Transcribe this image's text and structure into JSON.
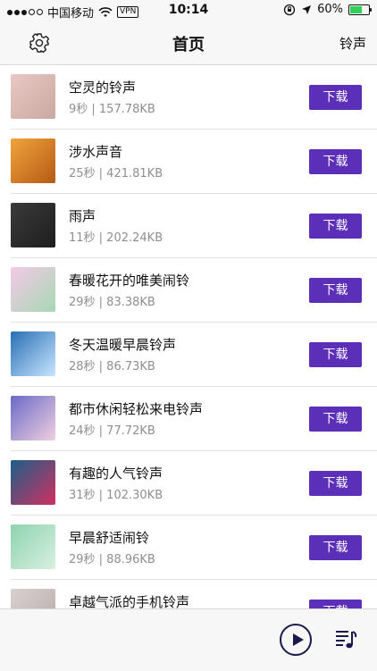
{
  "status_bar": {
    "carrier": "中国移动",
    "vpn": "VPN",
    "time": "10:14",
    "battery": "60%"
  },
  "nav": {
    "title": "首页",
    "right_label": "铃声",
    "settings_icon": "gear-icon"
  },
  "list": {
    "download_label": "下载",
    "items": [
      {
        "name": "空灵的铃声",
        "meta": "9秒 | 157.78KB",
        "thumb": [
          "#e9c8c4",
          "#c9a9a0"
        ]
      },
      {
        "name": "涉水声音",
        "meta": "25秒 | 421.81KB",
        "thumb": [
          "#f0a43a",
          "#b55a17"
        ]
      },
      {
        "name": "雨声",
        "meta": "11秒 | 202.24KB",
        "thumb": [
          "#3a3a3a",
          "#1e1e1e"
        ]
      },
      {
        "name": "春暖花开的唯美闹铃",
        "meta": "29秒 | 83.38KB",
        "thumb": [
          "#f4c9e6",
          "#a7d8b4"
        ]
      },
      {
        "name": "冬天温暖早晨铃声",
        "meta": "28秒 | 86.73KB",
        "thumb": [
          "#2a6fb5",
          "#c7e6ff"
        ]
      },
      {
        "name": "都市休闲轻松来电铃声",
        "meta": "24秒 | 77.72KB",
        "thumb": [
          "#6a6ac7",
          "#f0d0e0"
        ]
      },
      {
        "name": "有趣的人气铃声",
        "meta": "31秒 | 102.30KB",
        "thumb": [
          "#1b5f8a",
          "#d03060"
        ]
      },
      {
        "name": "早晨舒适闹铃",
        "meta": "29秒 | 88.96KB",
        "thumb": [
          "#8fd3b0",
          "#d8f0e0"
        ]
      },
      {
        "name": "卓越气派的手机铃声",
        "meta": "",
        "thumb": [
          "#d9d1d1",
          "#b7aaa8"
        ]
      }
    ]
  },
  "bottom": {
    "play_icon": "play-circle-icon",
    "queue_icon": "music-list-icon"
  },
  "colors": {
    "accent": "#5b2fb8",
    "meta_text": "#8e8e93"
  }
}
